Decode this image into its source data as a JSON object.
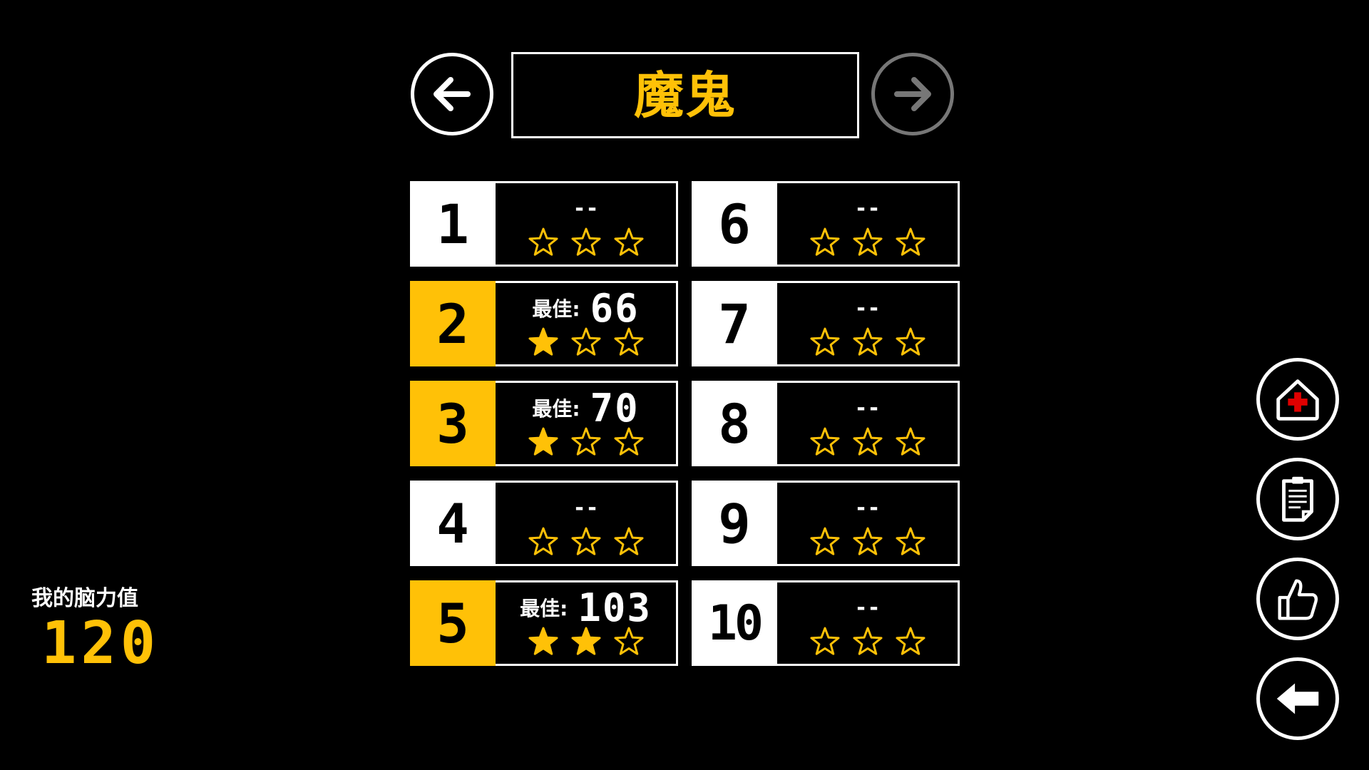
{
  "header": {
    "title": "魔鬼",
    "prev_icon": "arrow-left-icon",
    "next_icon": "arrow-right-icon"
  },
  "colors": {
    "accent": "#ffc107",
    "background": "#000000",
    "foreground": "#ffffff",
    "disabled": "#777777"
  },
  "levels": [
    {
      "number": "1",
      "best_label": "",
      "best": "--",
      "stars": 0,
      "played": false
    },
    {
      "number": "2",
      "best_label": "最佳:",
      "best": "66",
      "stars": 1,
      "played": true
    },
    {
      "number": "3",
      "best_label": "最佳:",
      "best": "70",
      "stars": 1,
      "played": true
    },
    {
      "number": "4",
      "best_label": "",
      "best": "--",
      "stars": 0,
      "played": false
    },
    {
      "number": "5",
      "best_label": "最佳:",
      "best": "103",
      "stars": 2,
      "played": true
    },
    {
      "number": "6",
      "best_label": "",
      "best": "--",
      "stars": 0,
      "played": false
    },
    {
      "number": "7",
      "best_label": "",
      "best": "--",
      "stars": 0,
      "played": false
    },
    {
      "number": "8",
      "best_label": "",
      "best": "--",
      "stars": 0,
      "played": false
    },
    {
      "number": "9",
      "best_label": "",
      "best": "--",
      "stars": 0,
      "played": false
    },
    {
      "number": "10",
      "best_label": "",
      "best": "--",
      "stars": 0,
      "played": false
    }
  ],
  "max_stars": 3,
  "brain_power": {
    "label": "我的脑力值",
    "value": "120"
  },
  "side_buttons": [
    {
      "icon": "hospital-house-icon"
    },
    {
      "icon": "clipboard-icon"
    },
    {
      "icon": "thumbs-up-icon"
    },
    {
      "icon": "back-arrow-icon"
    }
  ]
}
